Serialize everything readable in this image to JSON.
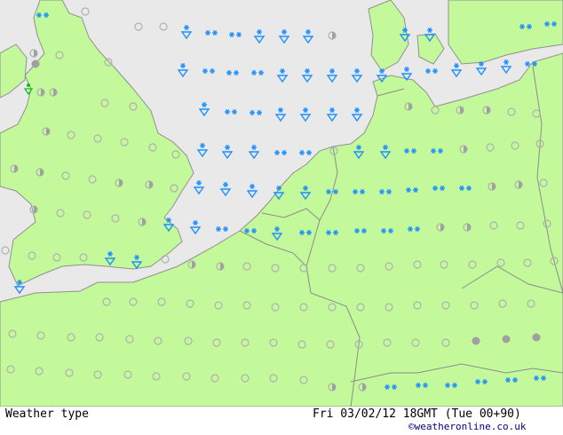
{
  "map": {
    "colors": {
      "sea": "#e9e9e9",
      "land": "#c3f99a",
      "border": "#8c8c8c",
      "coast": "#909090",
      "snow": "#1e90ff",
      "dry": "#b0b0b0",
      "cloud_fill": "#a0a0a0",
      "precip_green": "#10c010"
    },
    "symbols": {
      "snow_shower": "snow-shower-icon",
      "snow": "snow-icon",
      "clear": "clear-icon",
      "partly_cloudy": "partly-cloudy-icon",
      "overcast": "overcast-icon",
      "green_precip": "precip-icon"
    }
  },
  "footer": {
    "legend_title": "Weather type",
    "valid_time": "Fri 03/02/12 18GMT  (Tue 00+90)",
    "copyright": "©weatheronline.co.uk"
  }
}
